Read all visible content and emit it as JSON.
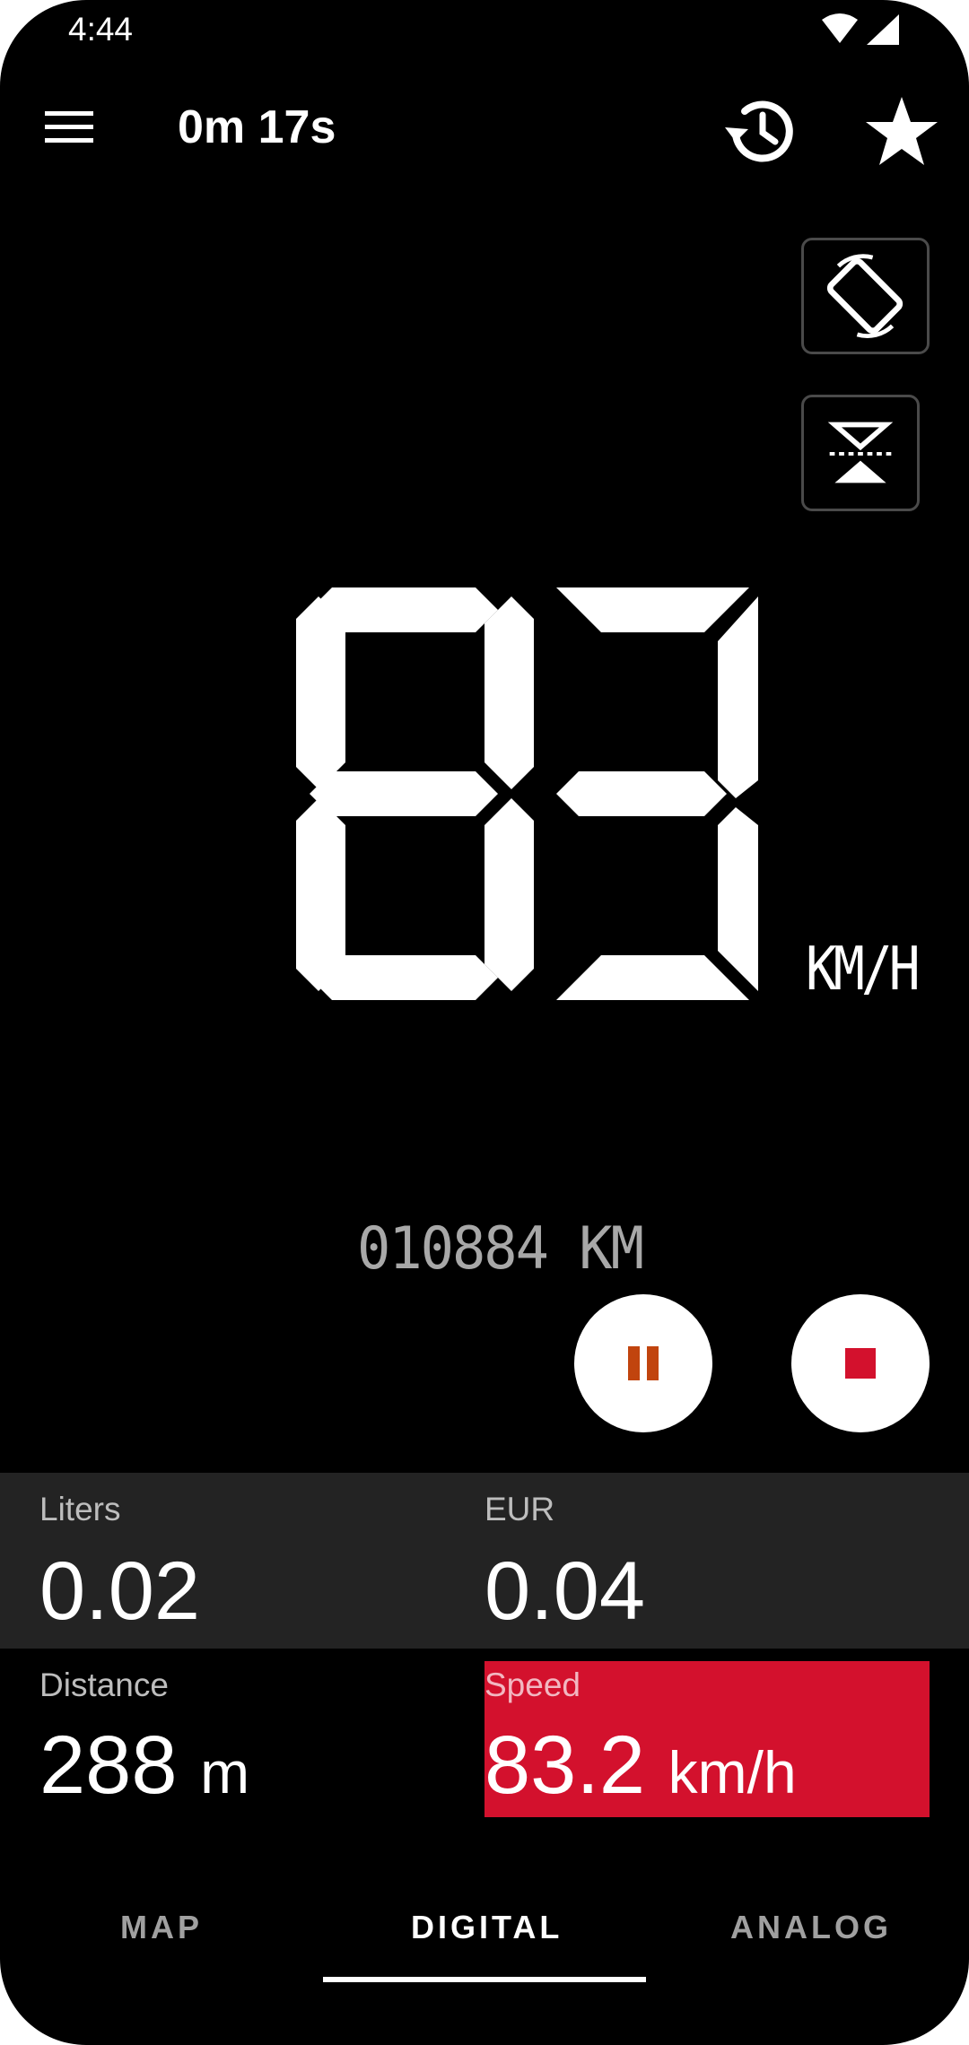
{
  "status_bar": {
    "time": "4:44",
    "icons": [
      "wifi-icon",
      "signal-icon"
    ]
  },
  "app_bar": {
    "title": "0m 17s",
    "menu_icon": "menu-icon",
    "history_icon": "history-icon",
    "favorite_icon": "star-icon"
  },
  "side_controls": [
    "screen-rotation-icon",
    "mirror-hud-icon"
  ],
  "speedometer": {
    "speed_display": "83",
    "unit": "KM/H",
    "odometer": "010884 KM"
  },
  "controls": {
    "pause_icon": "pause-icon",
    "stop_icon": "stop-icon"
  },
  "stats": {
    "liters": {
      "label": "Liters",
      "value": "0.02"
    },
    "currency": {
      "label": "EUR",
      "value": "0.04"
    },
    "distance": {
      "label": "Distance",
      "value": "288",
      "unit": "m"
    },
    "speed": {
      "label": "Speed",
      "value": "83.2",
      "unit": "km/h"
    }
  },
  "tabs": [
    {
      "label": "MAP",
      "active": false
    },
    {
      "label": "DIGITAL",
      "active": true
    },
    {
      "label": "ANALOG",
      "active": false
    }
  ],
  "colors": {
    "background": "#000000",
    "stats_panel": "#232323",
    "speed_highlight": "#d3112d",
    "pause_accent": "#c1440e",
    "stop_accent": "#d3112d"
  }
}
